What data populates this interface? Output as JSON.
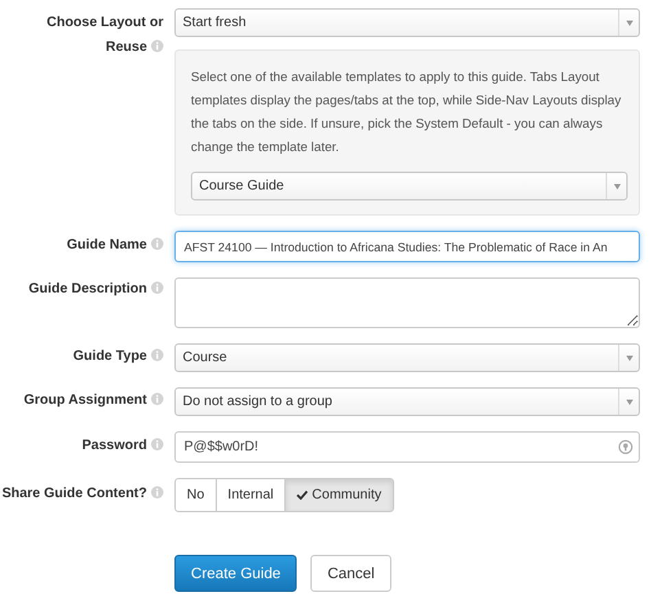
{
  "fields": [
    {
      "kind": "select",
      "label": "Choose Layout or Reuse",
      "value": "Start fresh",
      "panel": {
        "text": "Select one of the available templates to apply to this guide. Tabs Layout templates display the pages/tabs at the top, while Side-Nav Layouts display the tabs on the side. If unsure, pick the System Default - you can always change the template later.",
        "value": "Course Guide"
      }
    },
    {
      "kind": "text",
      "label": "Guide Name",
      "value": "AFST 24100 — Introduction to Africana Studies: The Problematic of Race in An",
      "focused": true
    },
    {
      "kind": "textarea",
      "label": "Guide Description"
    },
    {
      "kind": "select",
      "label": "Guide Type",
      "value": "Course"
    },
    {
      "kind": "select",
      "label": "Group Assignment",
      "value": "Do not assign to a group"
    },
    {
      "kind": "password",
      "label": "Password",
      "value": "P@$$w0rD!"
    },
    {
      "kind": "toggle",
      "label": "Share Guide Content?",
      "options": [
        {
          "label": "No",
          "selected": false
        },
        {
          "label": "Internal",
          "selected": false
        },
        {
          "label": "Community",
          "selected": true
        }
      ]
    }
  ],
  "buttons": [
    {
      "label": "Create Guide",
      "primary": true
    },
    {
      "label": "Cancel",
      "primary": false
    }
  ]
}
